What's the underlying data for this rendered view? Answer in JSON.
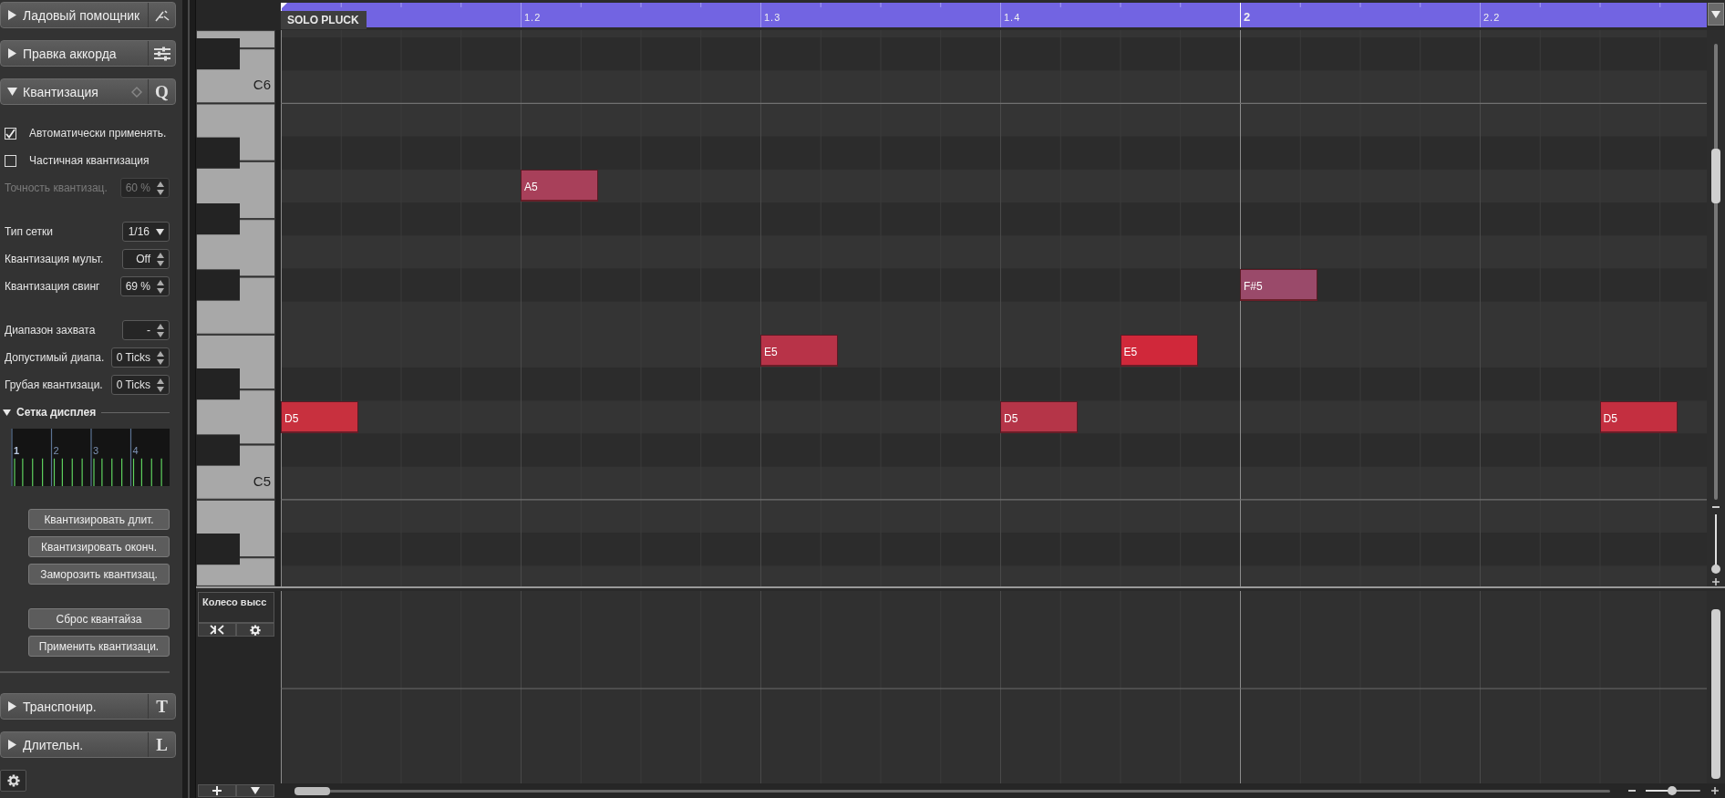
{
  "panel": {
    "sections": [
      {
        "title": "Ладовый помощник",
        "expanded": false,
        "kind": "scale"
      },
      {
        "title": "Правка аккорда",
        "expanded": false,
        "kind": "sliders"
      },
      {
        "title": "Квантизация",
        "expanded": true,
        "kind": "quantize",
        "letter": "Q",
        "content": {
          "groups": [
            [
              {
                "kind": "checkbox",
                "label": "Автоматически применять.",
                "checked": true,
                "disabled": false
              },
              {
                "kind": "checkbox",
                "label": "Частичная квантизация",
                "checked": false,
                "disabled": false
              },
              {
                "kind": "spinner",
                "label": "Точность квантизац.",
                "value": "60 %",
                "disabled": true
              }
            ],
            [
              {
                "kind": "dropdown",
                "label": "Тип сетки",
                "value": "1/16",
                "disabled": false
              },
              {
                "kind": "spinner",
                "label": "Квантизация мульт.",
                "value": "Off",
                "disabled": false
              },
              {
                "kind": "spinner",
                "label": "Квантизация свинг",
                "value": "69 %",
                "disabled": false
              }
            ],
            [
              {
                "kind": "spinner",
                "label": "Диапазон захвата",
                "value": "-",
                "disabled": false
              },
              {
                "kind": "spinner",
                "label": "Допустимый диапа.",
                "value": "0 Ticks",
                "disabled": false
              },
              {
                "kind": "spinner",
                "label": "Грубая квантизаци.",
                "value": "0 Ticks",
                "disabled": false
              }
            ]
          ],
          "display_grid": {
            "title": "Сетка дисплея",
            "expanded": true,
            "beat_labels": [
              "1",
              "2",
              "3",
              "4"
            ]
          },
          "button_groups": [
            [
              "Квантизировать длит.",
              "Квантизировать оконч.",
              "Заморозить квантизац."
            ],
            [
              "Сброс квантайза",
              "Применить квантизаци."
            ]
          ]
        }
      },
      {
        "title": "Транспонир.",
        "expanded": false,
        "kind": "letter",
        "letter": "T"
      },
      {
        "title": "Длительн.",
        "expanded": false,
        "kind": "letter",
        "letter": "L"
      }
    ]
  },
  "ruler": {
    "clip_name": "SOLO PLUCK",
    "beats": [
      {
        "notes": [
          {
            "label": "D5",
            "kind": "on_beat",
            "color": "#c8303e"
          }
        ]
      },
      {
        "label": "1.2",
        "kind": "beat",
        "notes": [
          {
            "label": "A5",
            "kind": "on_beat",
            "color": "#a8405a"
          }
        ]
      },
      {
        "label": "1.3",
        "kind": "beat",
        "notes": [
          {
            "label": "E5",
            "kind": "on_beat",
            "color": "#b83348"
          }
        ]
      },
      {
        "label": "1.4",
        "kind": "beat",
        "notes": [
          {
            "label": "D5",
            "kind": "on_beat",
            "color": "#b53548"
          },
          {
            "label": "E5",
            "kind": "half_beat",
            "color": "#d0283a"
          }
        ]
      },
      {
        "label": "2",
        "kind": "bar",
        "notes": [
          {
            "label": "F#5",
            "kind": "on_beat",
            "color": "#9a4a6a"
          }
        ]
      },
      {
        "label": "2.2",
        "kind": "beat",
        "notes": [
          {
            "label": "D5",
            "kind": "half_beat",
            "color": "#c42f40"
          }
        ]
      }
    ]
  },
  "keyboard": {
    "labels": [
      "C6",
      "C5"
    ]
  },
  "controller_lane": {
    "name": "Колесо высс"
  },
  "zoom": {
    "horizontal": {
      "level": 0.48
    },
    "vertical": {
      "level": 1
    }
  }
}
